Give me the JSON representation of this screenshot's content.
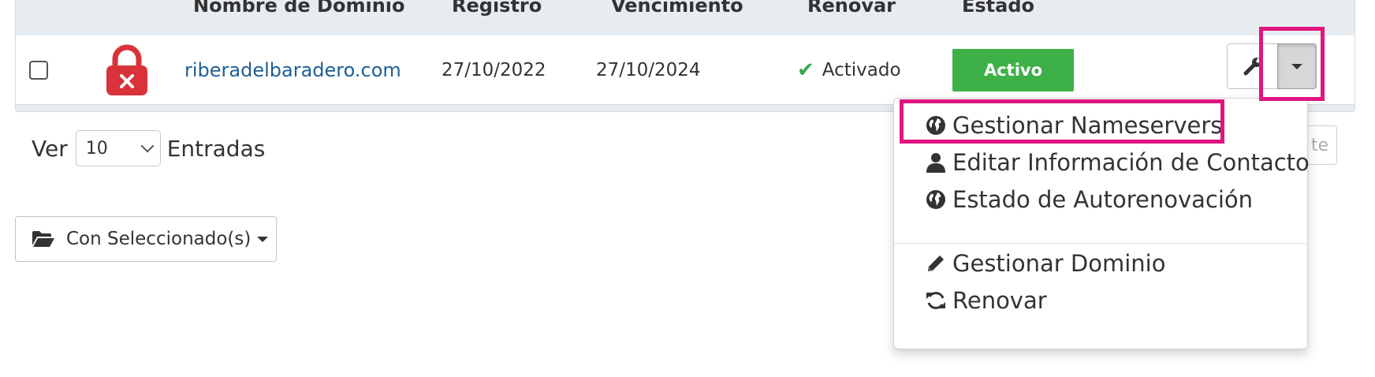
{
  "table": {
    "headers": {
      "domain": "Nombre de Dominio",
      "registration": "Registro",
      "expiry": "Vencimiento",
      "renew": "Renovar",
      "status": "Estado"
    },
    "rows": [
      {
        "domain": "riberadelbaradero.com",
        "registration": "27/10/2022",
        "expiry": "27/10/2024",
        "renew": "Activado",
        "status": "Activo"
      }
    ]
  },
  "length_select": {
    "prefix": "Ver",
    "value": "10",
    "suffix": "Entradas"
  },
  "bulk_actions": {
    "label": "Con Seleccionado(s)"
  },
  "hidden_button": {
    "text": "te"
  },
  "dropdown": {
    "items": [
      {
        "label": "Gestionar Nameservers",
        "icon": "globe-icon"
      },
      {
        "label": "Editar Información de Contacto",
        "icon": "user-icon"
      },
      {
        "label": "Estado de Autorenovación",
        "icon": "globe-icon"
      },
      {
        "label": "Gestionar Dominio",
        "icon": "pencil-icon"
      },
      {
        "label": "Renovar",
        "icon": "refresh-icon"
      }
    ]
  },
  "colors": {
    "highlight": "#e0157f",
    "status_active": "#3db048",
    "link": "#1f5f94",
    "check": "#3aa64a",
    "lock": "#d9323a"
  }
}
